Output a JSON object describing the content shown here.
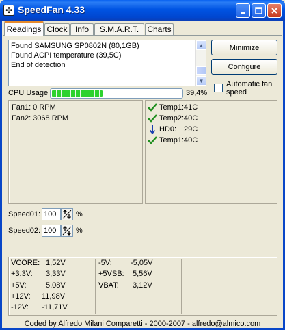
{
  "window": {
    "title": "SpeedFan 4.33",
    "icon_name": "fan-icon",
    "controls": [
      "minimize-icon",
      "maximize-icon",
      "close-icon"
    ]
  },
  "tabs": [
    {
      "label": "Readings",
      "active": true
    },
    {
      "label": "Clock"
    },
    {
      "label": "Info"
    },
    {
      "label": "S.M.A.R.T."
    },
    {
      "label": "Charts"
    }
  ],
  "log": {
    "lines": [
      "Found SAMSUNG SP0802N (80,1GB)",
      "Found ACPI temperature (39,5C)",
      "End of detection"
    ]
  },
  "buttons": {
    "minimize": "Minimize",
    "configure": "Configure"
  },
  "auto_fan_speed": {
    "label": "Automatic fan speed",
    "checked": false
  },
  "cpu_usage": {
    "label": "CPU Usage",
    "value_text": "39,4%",
    "percent": 39.4
  },
  "fans": [
    "Fan1: 0 RPM",
    "Fan2: 3068 RPM"
  ],
  "temps": [
    {
      "label": "Temp1:",
      "value": "41C",
      "icon": "check-icon"
    },
    {
      "label": "Temp2:",
      "value": "40C",
      "icon": "check-icon"
    },
    {
      "label": "HD0:",
      "value": "29C",
      "icon": "arrow-down-icon"
    },
    {
      "label": "Temp1:",
      "value": "40C",
      "icon": "check-icon"
    }
  ],
  "speeds": [
    {
      "label": "Speed01:",
      "value": "100",
      "unit": "%"
    },
    {
      "label": "Speed02:",
      "value": "100",
      "unit": "%"
    }
  ],
  "voltages": {
    "col1": [
      {
        "label": "VCORE:",
        "value": "1,52V"
      },
      {
        "label": "+3.3V:",
        "value": "3,33V"
      },
      {
        "label": "+5V:",
        "value": "5,08V"
      },
      {
        "label": "+12V:",
        "value": "11,98V"
      },
      {
        "label": "-12V:",
        "value": "-11,71V"
      }
    ],
    "col2": [
      {
        "label": "-5V:",
        "value": "-5,05V"
      },
      {
        "label": "+5VSB:",
        "value": "5,56V"
      },
      {
        "label": "VBAT:",
        "value": "3,12V"
      }
    ]
  },
  "status": "Coded by Alfredo Milani Comparetti - 2000-2007 - alfredo@almico.com",
  "colors": {
    "titlebar": "#0054e3",
    "ok": "#1e8e1e",
    "down": "#1a3fb0",
    "progress": "#2dd22d"
  }
}
